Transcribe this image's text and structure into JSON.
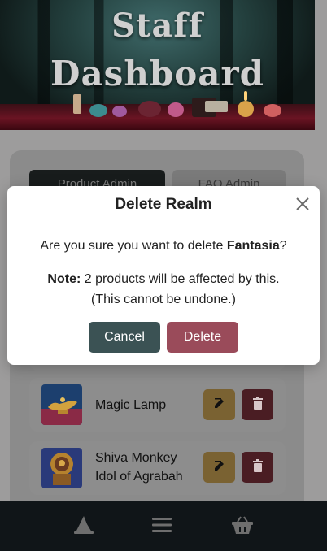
{
  "hero": {
    "title_line1": "Staff",
    "title_line2": "Dashboard"
  },
  "tabs": [
    {
      "label": "Product Admin"
    },
    {
      "label": "FAQ Admin"
    }
  ],
  "products": [
    {
      "name": "Magic Lamp"
    },
    {
      "name_line1": "Shiva Monkey",
      "name_line2": "Idol of Agrabah"
    }
  ],
  "modal": {
    "title": "Delete Realm",
    "question_prefix": "Are you sure you want to delete ",
    "realm_name": "Fantasia",
    "question_suffix": "?",
    "note_label": "Note:",
    "note_text": " 2 products will be affected by this.",
    "warning": "(This cannot be undone.)",
    "cancel_label": "Cancel",
    "delete_label": "Delete"
  },
  "icons": {
    "close": "close-icon",
    "edit": "edit-icon",
    "trash": "trash-icon",
    "wizard": "wizard-hat-icon",
    "menu": "menu-icon",
    "basket": "basket-icon"
  },
  "colors": {
    "cancel": "#3b5254",
    "delete": "#9a4b5a",
    "edit": "#c89b4a",
    "trash": "#7c2f3c"
  }
}
